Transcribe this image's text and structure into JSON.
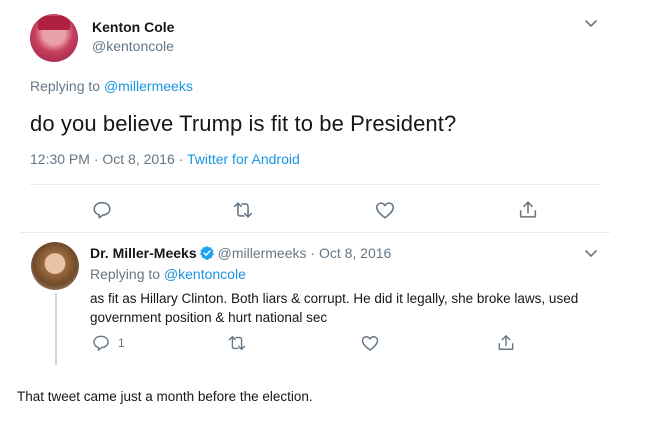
{
  "main_tweet": {
    "name": "Kenton Cole",
    "handle": "@kentoncole",
    "replying_prefix": "Replying to ",
    "replying_to": "@millermeeks",
    "text": "do you believe Trump is fit to be President?",
    "meta_time": "12:30 PM · Oct 8, 2016 · ",
    "meta_source": "Twitter for Android"
  },
  "reply_tweet": {
    "name": "Dr. Miller-Meeks",
    "handle_date": "@millermeeks · Oct 8, 2016",
    "replying_prefix": "Replying to ",
    "replying_to": "@kentoncole",
    "text": "as fit as Hillary Clinton. Both liars & corrupt. He did it legally, she broke laws, used government position & hurt national sec",
    "reply_count": "1"
  },
  "caption": "That tweet came just a month before the election.",
  "icons": [
    "reply-icon",
    "retweet-icon",
    "like-icon",
    "share-icon",
    "chevron-down-icon",
    "verified-badge-icon"
  ],
  "colors": {
    "link": "#1b95e0",
    "muted": "#657786",
    "text": "#14171a",
    "icon": "#657786",
    "verified": "#1da1f2"
  }
}
